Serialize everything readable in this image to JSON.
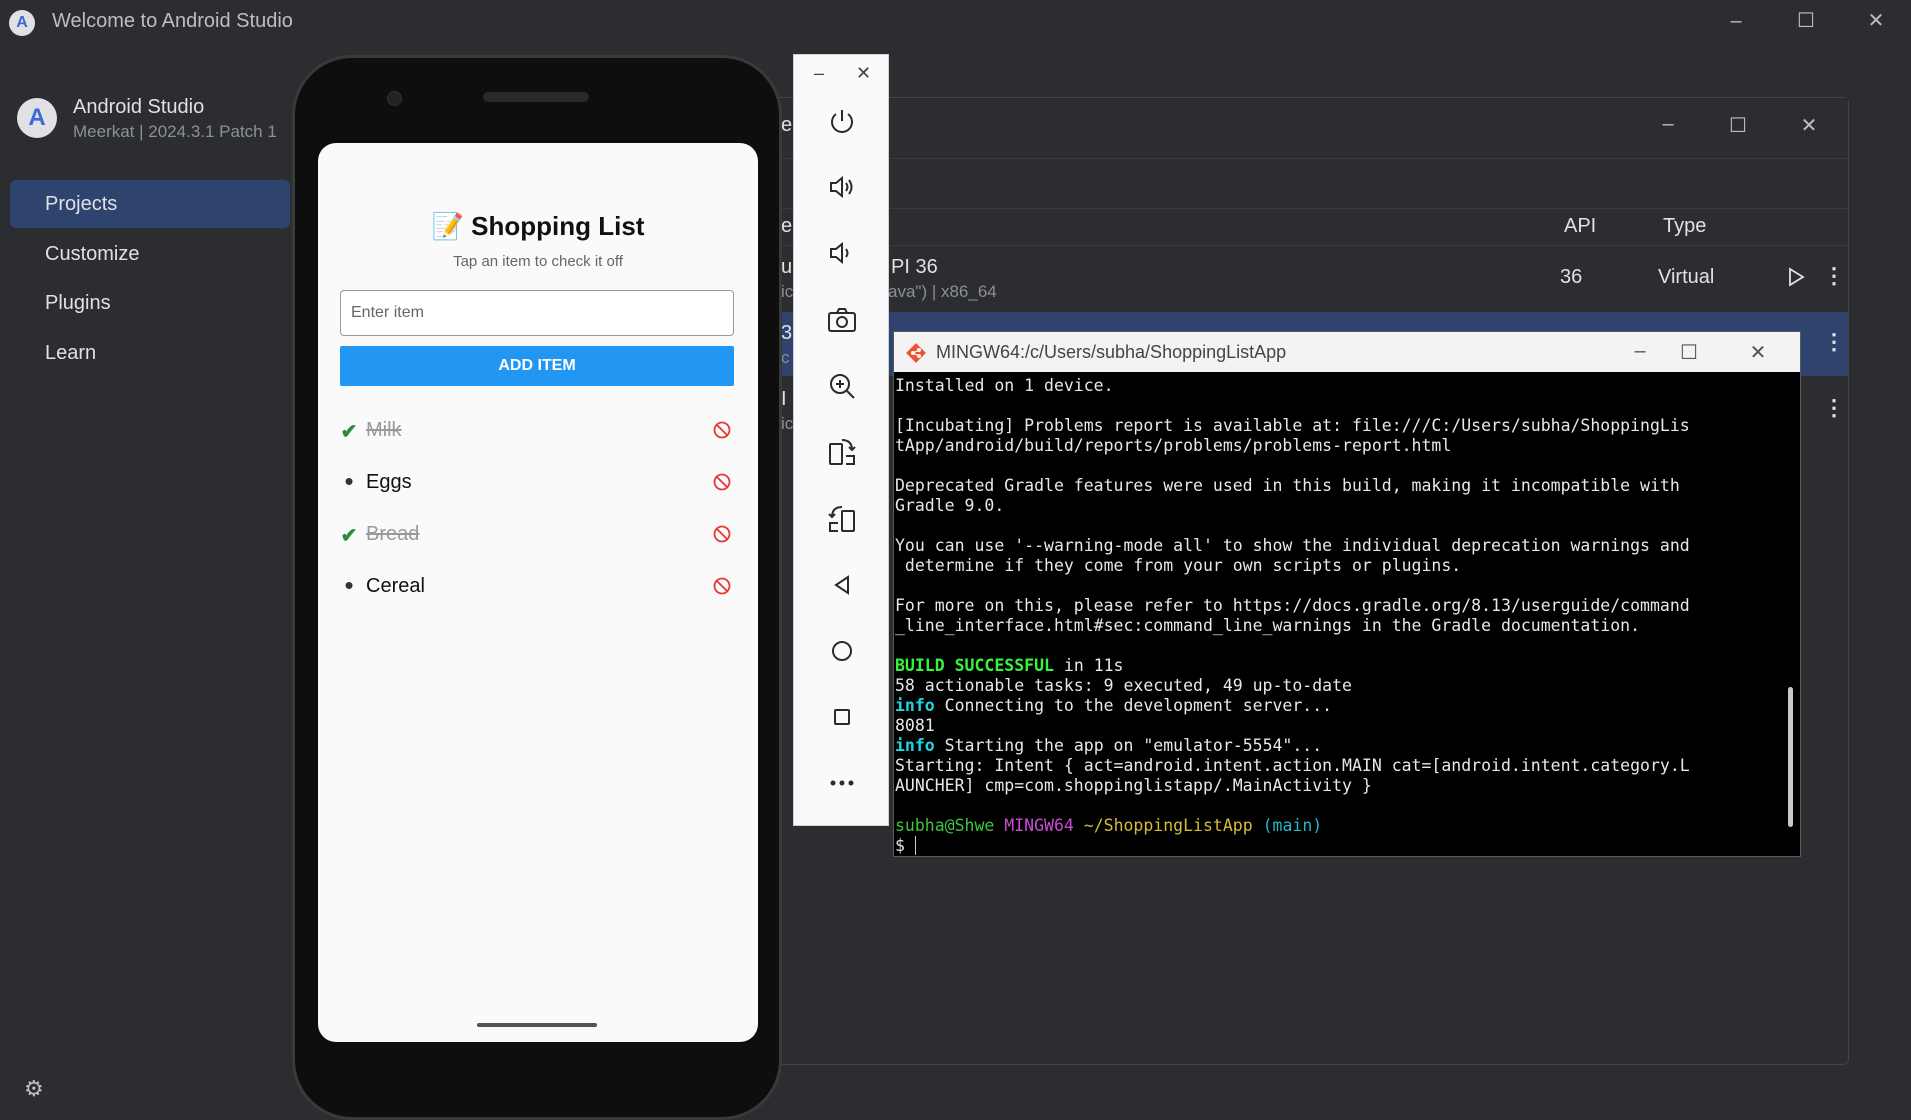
{
  "main_window": {
    "title": "Welcome to Android Studio",
    "window_controls": {
      "minimize": "–",
      "maximize": "☐",
      "close": "✕"
    }
  },
  "sidebar": {
    "app_name": "Android Studio",
    "version": "Meerkat | 2024.3.1 Patch 1",
    "items": [
      {
        "label": "Projects",
        "active": true
      },
      {
        "label": "Customize",
        "active": false
      },
      {
        "label": "Plugins",
        "active": false
      },
      {
        "label": "Learn",
        "active": false
      }
    ],
    "settings_icon": "gear-icon"
  },
  "device_manager": {
    "header_fragment": "e",
    "columns": {
      "name_fragment": "e",
      "api": "API",
      "type": "Type"
    },
    "rows": [
      {
        "name": "u",
        "name_tail": "PI 36",
        "sub": "ic",
        "sub_tail": "ava\") | x86_64",
        "api": "36",
        "type": "Virtual"
      },
      {
        "name": "3",
        "sub": "c"
      },
      {
        "name": "I",
        "sub": "ic"
      }
    ]
  },
  "emulator_toolbar": {
    "controls": {
      "minimize": "–",
      "close": "✕"
    },
    "buttons": [
      "power-icon",
      "volume-up-icon",
      "volume-down-icon",
      "camera-icon",
      "zoom-icon",
      "rotate-left-icon",
      "rotate-right-icon",
      "back-icon",
      "home-icon",
      "overview-icon",
      "more-icon"
    ]
  },
  "app": {
    "title": "📝 Shopping List",
    "subtitle": "Tap an item to check it off",
    "input_placeholder": "Enter item",
    "add_button": "ADD ITEM",
    "items": [
      {
        "label": "Milk",
        "done": true
      },
      {
        "label": "Eggs",
        "done": false
      },
      {
        "label": "Bread",
        "done": true
      },
      {
        "label": "Cereal",
        "done": false
      }
    ],
    "check_symbol": "✔",
    "dot_symbol": "•"
  },
  "terminal": {
    "title": "MINGW64:/c/Users/subha/ShoppingListApp",
    "lines": {
      "l1": "Installed on 1 device.",
      "l2": "[Incubating] Problems report is available at: file:///C:/Users/subha/ShoppingLis",
      "l3": "tApp/android/build/reports/problems/problems-report.html",
      "l4": "Deprecated Gradle features were used in this build, making it incompatible with",
      "l5": "Gradle 9.0.",
      "l6": "You can use '--warning-mode all' to show the individual deprecation warnings and",
      "l7": " determine if they come from your own scripts or plugins.",
      "l8": "For more on this, please refer to https://docs.gradle.org/8.13/userguide/command",
      "l9": "_line_interface.html#sec:command_line_warnings in the Gradle documentation.",
      "build_ok": "BUILD SUCCESSFUL",
      "build_time": " in 11s",
      "l11": "58 actionable tasks: 9 executed, 49 up-to-date",
      "info": "info",
      "l12": " Connecting to the development server...",
      "l13": "8081",
      "l14": " Starting the app on \"emulator-5554\"...",
      "l15": "Starting: Intent { act=android.intent.action.MAIN cat=[android.intent.category.L",
      "l16": "AUNCHER] cmp=com.shoppinglistapp/.MainActivity }",
      "prompt_user": "subha@Shwe",
      "prompt_shell": "MINGW64",
      "prompt_path": "~/ShoppingListApp",
      "prompt_branch": "(main)",
      "prompt_symbol": "$ "
    }
  }
}
